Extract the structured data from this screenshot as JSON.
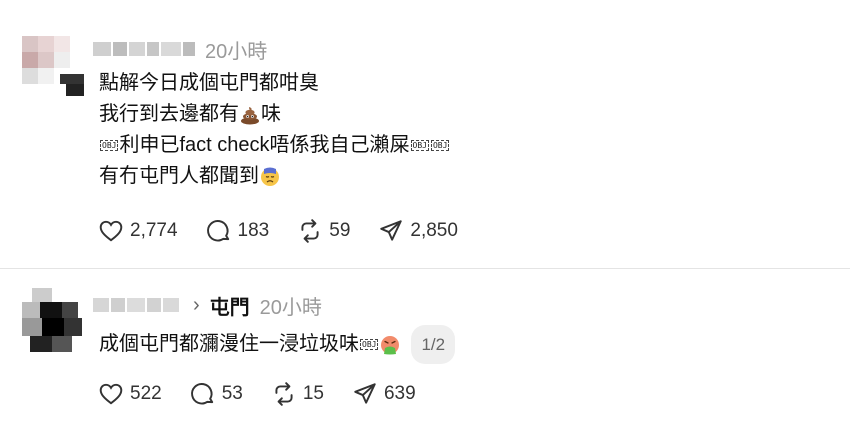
{
  "posts": [
    {
      "time": "20小時",
      "lines": [
        "點解今日成個屯門都咁臭",
        "我行到去邊都有",
        "味",
        "利申已fact check唔係我自己瀨屎",
        "有冇屯門人都聞到"
      ],
      "obj_marker": "OBJ",
      "actions": {
        "likes": "2,774",
        "comments": "183",
        "reposts": "59",
        "shares": "2,850"
      }
    },
    {
      "reply_to": "屯門",
      "time": "20小時",
      "text": "成個屯門都瀰漫住一浸垃圾味",
      "page": "1/2",
      "obj_marker": "OBJ",
      "actions": {
        "likes": "522",
        "comments": "53",
        "reposts": "15",
        "shares": "639"
      }
    }
  ],
  "icons": [
    "heart-icon",
    "comment-icon",
    "repost-icon",
    "share-icon",
    "poop-emoji",
    "disappointed-emoji",
    "vomit-emoji",
    "chevron-right-icon"
  ]
}
